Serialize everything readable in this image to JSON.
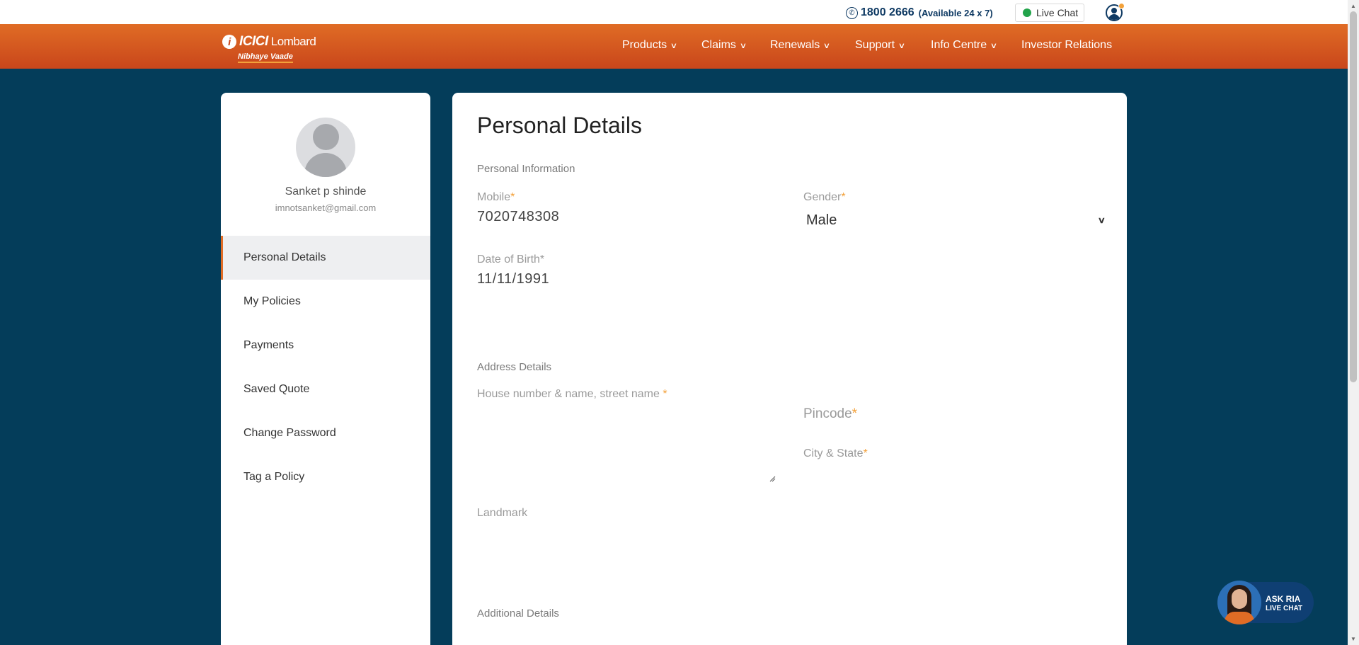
{
  "topbar": {
    "phone_number": "1800 2666",
    "availability": "(Available 24 x 7)",
    "live_chat_label": "Live Chat"
  },
  "brand": {
    "logo_line1": "ICICI",
    "logo_line1b": "Lombard",
    "logo_line2": "Nibhaye Vaade"
  },
  "nav": {
    "items": [
      {
        "label": "Products"
      },
      {
        "label": "Claims"
      },
      {
        "label": "Renewals"
      },
      {
        "label": "Support"
      },
      {
        "label": "Info Centre"
      },
      {
        "label": "Investor Relations"
      }
    ]
  },
  "sidebar": {
    "user_name": "Sanket p shinde",
    "user_email": "imnotsanket@gmail.com",
    "items": [
      {
        "label": "Personal Details",
        "active": true
      },
      {
        "label": "My Policies"
      },
      {
        "label": "Payments"
      },
      {
        "label": "Saved Quote"
      },
      {
        "label": "Change Password"
      },
      {
        "label": "Tag a Policy"
      }
    ]
  },
  "main": {
    "title": "Personal Details",
    "personal_info_heading": "Personal Information",
    "mobile_label": "Mobile",
    "mobile_value": "7020748308",
    "gender_label": "Gender",
    "gender_value": "Male",
    "dob_label": "Date of Birth*",
    "dob_value": "11/11/1991",
    "address_heading": "Address Details",
    "house_label": "House number & name, street name",
    "pincode_label": "Pincode",
    "city_state_label": "City & State",
    "landmark_label": "Landmark",
    "additional_heading": "Additional Details",
    "required_mark": "*"
  },
  "chat_widget": {
    "line1": "ASK RIA",
    "line2": "LIVE CHAT"
  },
  "colors": {
    "page_bg": "#043d5a",
    "nav_orange": "#e06c25",
    "accent": "#f3a13a",
    "navy": "#0f3a63"
  }
}
